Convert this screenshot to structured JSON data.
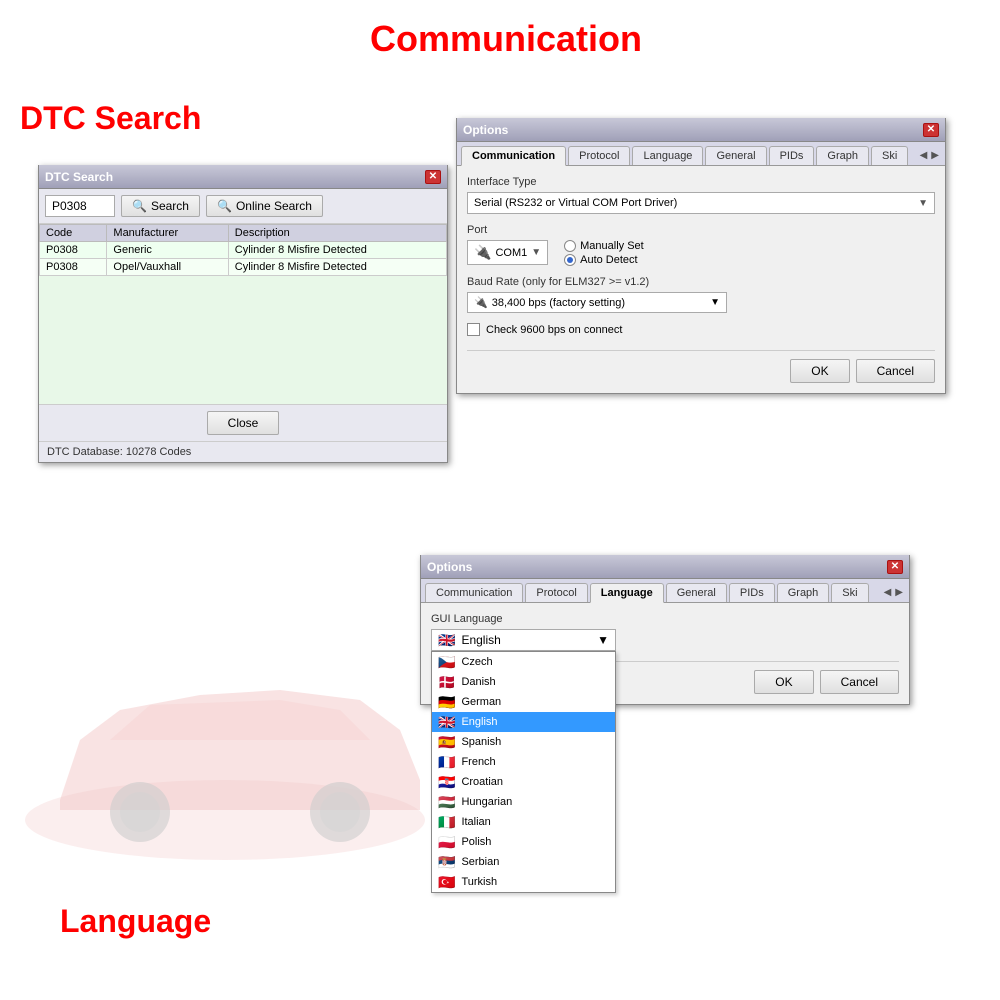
{
  "labels": {
    "communication": "Communication",
    "dtc_search": "DTC Search",
    "language": "Language"
  },
  "options_comm": {
    "title": "Options",
    "tabs": [
      "Communication",
      "Protocol",
      "Language",
      "General",
      "PIDs",
      "Graph",
      "Ski"
    ],
    "active_tab": "Communication",
    "interface_type_label": "Interface Type",
    "interface_type_value": "Serial (RS232 or Virtual COM Port Driver)",
    "port_label": "Port",
    "port_value": "COM1",
    "manually_set": "Manually Set",
    "auto_detect": "Auto Detect",
    "baud_rate_label": "Baud Rate (only for ELM327 >= v1.2)",
    "baud_rate_value": "38,400 bps (factory setting)",
    "check_9600": "Check 9600 bps on connect",
    "ok": "OK",
    "cancel": "Cancel"
  },
  "dtc_search": {
    "title": "DTC Search",
    "code_input": "P0308",
    "search_btn": "Search",
    "online_search_btn": "Online Search",
    "columns": [
      "Code",
      "Manufacturer",
      "Description"
    ],
    "rows": [
      [
        "P0308",
        "Generic",
        "Cylinder 8 Misfire Detected"
      ],
      [
        "P0308",
        "Opel/Vauxhall",
        "Cylinder 8 Misfire Detected"
      ]
    ],
    "footer": "DTC Database: 10278 Codes",
    "close_btn": "Close"
  },
  "options_lang": {
    "title": "Options",
    "tabs": [
      "Communication",
      "Protocol",
      "Language",
      "General",
      "PIDs",
      "Graph",
      "Ski"
    ],
    "active_tab": "Language",
    "gui_language_label": "GUI Language",
    "selected_language": "English",
    "languages": [
      {
        "name": "English",
        "flag": "🇬🇧"
      },
      {
        "name": "Czech",
        "flag": "🇨🇿"
      },
      {
        "name": "Danish",
        "flag": "🇩🇰"
      },
      {
        "name": "German",
        "flag": "🇩🇪"
      },
      {
        "name": "English",
        "flag": "🇬🇧"
      },
      {
        "name": "Spanish",
        "flag": "🇪🇸"
      },
      {
        "name": "French",
        "flag": "🇫🇷"
      },
      {
        "name": "Croatian",
        "flag": "🇭🇷"
      },
      {
        "name": "Hungarian",
        "flag": "🇭🇺"
      },
      {
        "name": "Italian",
        "flag": "🇮🇹"
      },
      {
        "name": "Polish",
        "flag": "🇵🇱"
      },
      {
        "name": "Serbian",
        "flag": "🇷🇸"
      },
      {
        "name": "Turkish",
        "flag": "🇹🇷"
      }
    ],
    "ok": "OK",
    "cancel": "Cancel"
  }
}
